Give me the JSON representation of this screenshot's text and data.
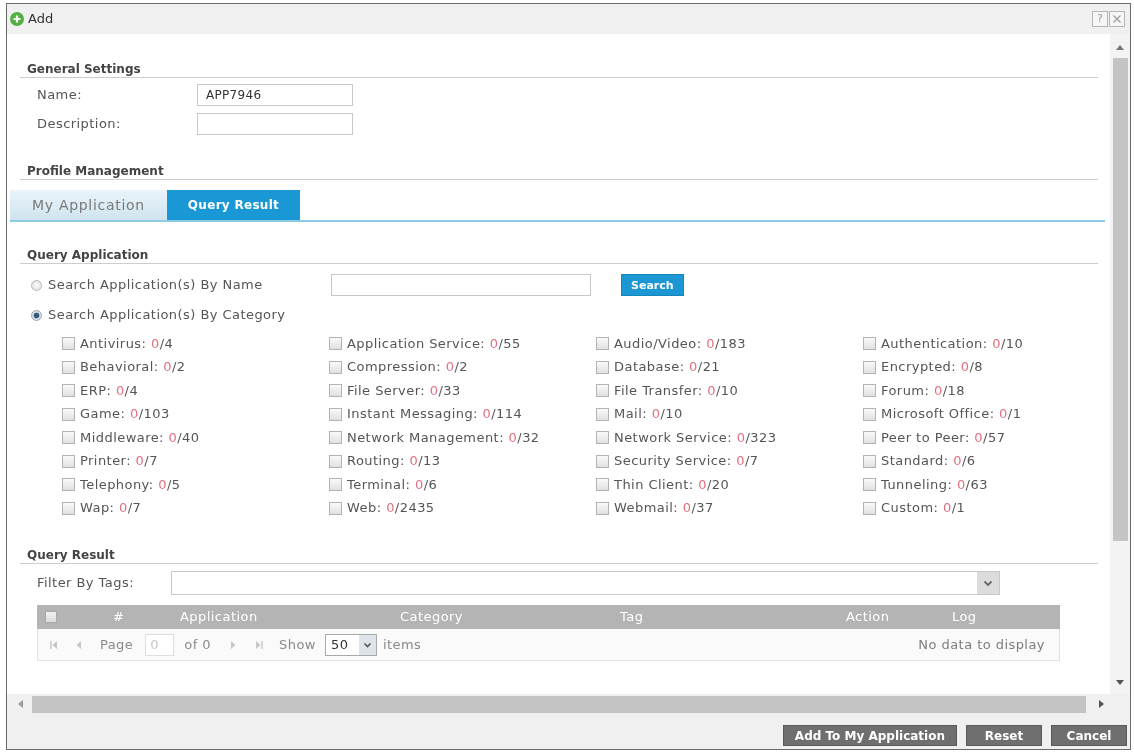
{
  "window": {
    "title": "Add",
    "help_button": "?"
  },
  "general_settings": {
    "heading": "General Settings",
    "fields": [
      {
        "label": "Name:",
        "value": "APP7946"
      },
      {
        "label": "Description:"
      }
    ]
  },
  "profile_management": {
    "heading": "Profile Management",
    "tabs": [
      {
        "label": "My Application",
        "selected": false
      },
      {
        "label": "Query Result",
        "selected": true
      }
    ]
  },
  "query_application": {
    "heading": "Query Application",
    "search_options": [
      {
        "label": "Search Application(s) By Name",
        "selected": false
      },
      {
        "label": "Search Application(s) By Category",
        "selected": true
      }
    ],
    "search_button": "Search",
    "categories": [
      {
        "label": "Antivirus:",
        "count": "0",
        "total": "/4",
        "checked": false
      },
      {
        "label": "Application Service:",
        "count": "0",
        "total": "/55",
        "checked": false
      },
      {
        "label": "Audio/Video:",
        "count": "0",
        "total": "/183",
        "checked": false
      },
      {
        "label": "Authentication:",
        "count": "0",
        "total": "/10",
        "checked": false
      },
      {
        "label": "Behavioral:",
        "count": "0",
        "total": "/2",
        "checked": false
      },
      {
        "label": "Compression:",
        "count": "0",
        "total": "/2",
        "checked": false
      },
      {
        "label": "Database:",
        "count": "0",
        "total": "/21",
        "checked": false
      },
      {
        "label": "Encrypted:",
        "count": "0",
        "total": "/8",
        "checked": false
      },
      {
        "label": "ERP:",
        "count": "0",
        "total": "/4",
        "checked": false
      },
      {
        "label": "File Server:",
        "count": "0",
        "total": "/33",
        "checked": false
      },
      {
        "label": "File Transfer:",
        "count": "0",
        "total": "/10",
        "checked": false
      },
      {
        "label": "Forum:",
        "count": "0",
        "total": "/18",
        "checked": false
      },
      {
        "label": "Game:",
        "count": "0",
        "total": "/103",
        "checked": false
      },
      {
        "label": "Instant Messaging:",
        "count": "0",
        "total": "/114",
        "checked": false
      },
      {
        "label": "Mail:",
        "count": "0",
        "total": "/10",
        "checked": false
      },
      {
        "label": "Microsoft Office:",
        "count": "0",
        "total": "/1",
        "checked": false
      },
      {
        "label": "Middleware:",
        "count": "0",
        "total": "/40",
        "checked": false
      },
      {
        "label": "Network Management:",
        "count": "0",
        "total": "/32",
        "checked": false
      },
      {
        "label": "Network Service:",
        "count": "0",
        "total": "/323",
        "checked": false
      },
      {
        "label": "Peer to Peer:",
        "count": "0",
        "total": "/57",
        "checked": false
      },
      {
        "label": "Printer:",
        "count": "0",
        "total": "/7",
        "checked": false
      },
      {
        "label": "Routing:",
        "count": "0",
        "total": "/13",
        "checked": false
      },
      {
        "label": "Security Service:",
        "count": "0",
        "total": "/7",
        "checked": false
      },
      {
        "label": "Standard:",
        "count": "0",
        "total": "/6",
        "checked": false
      },
      {
        "label": "Telephony:",
        "count": "0",
        "total": "/5",
        "checked": false
      },
      {
        "label": "Terminal:",
        "count": "0",
        "total": "/6",
        "checked": false
      },
      {
        "label": "Thin Client:",
        "count": "0",
        "total": "/20",
        "checked": false
      },
      {
        "label": "Tunneling:",
        "count": "0",
        "total": "/63",
        "checked": false
      },
      {
        "label": "Wap:",
        "count": "0",
        "total": "/7",
        "checked": false
      },
      {
        "label": "Web:",
        "count": "0",
        "total": "/2435",
        "checked": false
      },
      {
        "label": "Webmail:",
        "count": "0",
        "total": "/37",
        "checked": false
      },
      {
        "label": "Custom:",
        "count": "0",
        "total": "/1",
        "checked": false
      }
    ]
  },
  "query_result": {
    "heading": "Query Result",
    "filter_label": "Filter By Tags:",
    "table": {
      "select_all_checked": false,
      "columns": [
        "#",
        "Application",
        "Category",
        "Tag",
        "Action",
        "Log"
      ],
      "pager": {
        "page_label": "Page",
        "page": "0",
        "page_count": "of 0",
        "show_label": "Show",
        "page_size": "50",
        "items_label": "items"
      },
      "empty_message": "No data to display"
    }
  },
  "buttons": [
    "Add To My Application",
    "Reset",
    "Cancel"
  ]
}
